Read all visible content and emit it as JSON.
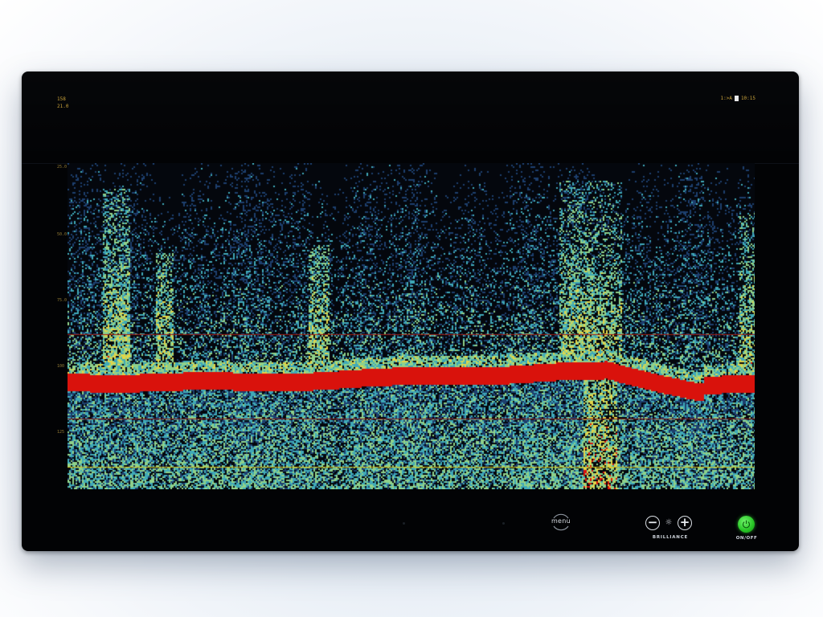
{
  "status": {
    "top_left_line1": "158",
    "top_left_line2": "21.0",
    "top_right_text": "1:>A",
    "top_right_suffix": "10:15"
  },
  "depth_scale": {
    "labels": [
      "25.0",
      "50.0",
      "75.0",
      "100",
      "125"
    ]
  },
  "sounder": {
    "palette": {
      "background": "#04070d",
      "weak": "#1d3f6e",
      "medium": "#3fa9b8",
      "strong": "#e3d548",
      "bottom": "#d9120c"
    },
    "reference_lines": [
      {
        "name": "upper-red-line",
        "color": "#a11c14"
      },
      {
        "name": "middle-red-line",
        "color": "#8a1a12"
      },
      {
        "name": "yellow-line",
        "color": "#d7c21b"
      }
    ]
  },
  "controls": {
    "menu_label": "menu",
    "minus_label": "−",
    "plus_label": "+",
    "brilliance_label": "BRILLIANCE",
    "power_label": "ON/OFF",
    "power_color": "#2fcf2d"
  }
}
